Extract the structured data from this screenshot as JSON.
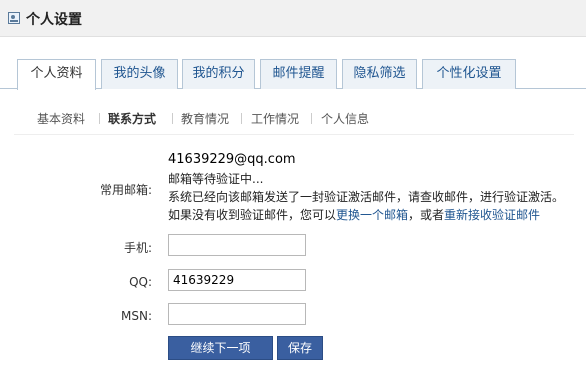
{
  "header": {
    "title": "个人设置"
  },
  "tabs": [
    {
      "label": "个人资料",
      "active": true
    },
    {
      "label": "我的头像"
    },
    {
      "label": "我的积分"
    },
    {
      "label": "邮件提醒"
    },
    {
      "label": "隐私筛选"
    },
    {
      "label": "个性化设置"
    }
  ],
  "subnav": [
    {
      "label": "基本资料"
    },
    {
      "label": "联系方式",
      "active": true
    },
    {
      "label": "教育情况"
    },
    {
      "label": "工作情况"
    },
    {
      "label": "个人信息"
    }
  ],
  "form": {
    "email_label": "常用邮箱:",
    "email_value": "41639229@qq.com",
    "email_status": "邮箱等待验证中...",
    "email_notice": "系统已经向该邮箱发送了一封验证激活邮件，请查收邮件，进行验证激活。",
    "email_help_prefix": "如果没有收到验证邮件，您可以",
    "email_change_link": "更换一个邮箱",
    "email_help_middle": "，或者",
    "email_resend_link": "重新接收验证邮件",
    "phone_label": "手机:",
    "phone_value": "",
    "qq_label": "QQ:",
    "qq_value": "41639229",
    "msn_label": "MSN:",
    "msn_value": ""
  },
  "buttons": {
    "next_label": "继续下一项",
    "save_label": "保存"
  },
  "colors": {
    "tab_link": "#1f5590",
    "button_bg": "#3a5fa0"
  }
}
